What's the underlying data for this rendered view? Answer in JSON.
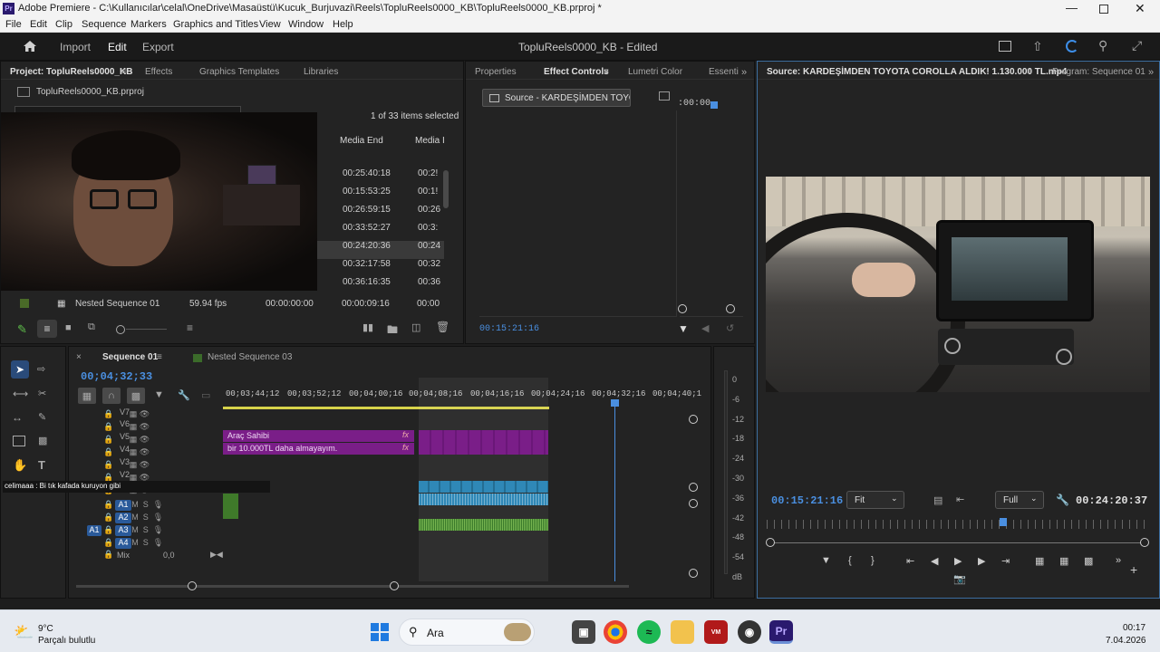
{
  "window": {
    "app_icon": "Pr",
    "title": "Adobe Premiere - C:\\Kullanıcılar\\celal\\OneDrive\\Masaüstü\\Kucuk_Burjuvazi\\Reels\\TopluReels0000_KB\\TopluReels0000_KB.prproj *"
  },
  "menu": [
    "File",
    "Edit",
    "Clip",
    "Sequence",
    "Markers",
    "Graphics and Titles",
    "View",
    "Window",
    "Help"
  ],
  "workspace": {
    "tabs": [
      "Import",
      "Edit",
      "Export"
    ],
    "active": "Edit",
    "project_title": "TopluReels0000_KB - Edited"
  },
  "project": {
    "tab": "Project: TopluReels0000_KB",
    "tabs": [
      "Effects",
      "Graphics Templates",
      "Libraries"
    ],
    "file": "TopluReels0000_KB.prproj",
    "selection": "1 of 33 items selected",
    "col_media_end": "Media End",
    "col_media_dur": "Media I",
    "rows": [
      {
        "end": "00:25:40:18",
        "dur": "00:2!"
      },
      {
        "end": "00:15:53:25",
        "dur": "00:1!"
      },
      {
        "end": "00:26:59:15",
        "dur": "00:26"
      },
      {
        "end": "00:33:52:27",
        "dur": "00:3:"
      },
      {
        "end": "00:24:20:36",
        "dur": "00:24"
      },
      {
        "end": "00:32:17:58",
        "dur": "00:32"
      },
      {
        "end": "00:36:16:35",
        "dur": "00:36"
      },
      {
        "end": "00:00:09:16",
        "dur": "00:00"
      }
    ],
    "nested_row": {
      "name": "Nested Sequence 01",
      "fps": "59.94 fps",
      "start": "00:00:00:00"
    }
  },
  "effects": {
    "tabs": [
      "Properties",
      "Effect Controls",
      "Lumetri Color",
      "Essenti"
    ],
    "source_label": "Source - KARDEŞİMDEN TOYO...",
    "mini_time": ":00:00",
    "time": "00:15:21:16"
  },
  "timeline": {
    "tabs": [
      "Sequence 01",
      "Nested Sequence 03"
    ],
    "timecode": "00;04;32;33",
    "ruler": [
      "00;03;44;12",
      "00;03;52;12",
      "00;04;00;16",
      "00;04;08;16",
      "00;04;16;16",
      "00;04;24;16",
      "00;04;32;16",
      "00;04;40;1"
    ],
    "video_tracks": [
      "V7",
      "V6",
      "V5",
      "V4",
      "V3",
      "V2",
      "V1"
    ],
    "audio_tracks": [
      "A1",
      "A2",
      "A3",
      "A4"
    ],
    "mix_label": "Mix",
    "mix_value": "0,0",
    "clips": [
      {
        "track": "V5",
        "text": "Araç Sahibi"
      },
      {
        "track": "V4",
        "text": "bir 10.000TL daha almayayım."
      }
    ],
    "fx": "fx",
    "caption_overlay": "celimaaa : Bi tık kafada kuruyon gibi"
  },
  "meter": {
    "scale": [
      "0",
      "-6",
      "-12",
      "-18",
      "-24",
      "-30",
      "-36",
      "-42",
      "-48",
      "-54",
      "dB"
    ]
  },
  "source": {
    "tab": "Source: KARDEŞİMDEN TOYOTA COROLLA ALDIK! 1.130.000 TL.mp4",
    "program_tab": "Program: Sequence 01",
    "time_in": "00:15:21:16",
    "fit": "Fit",
    "full": "Full",
    "duration": "00:24:20:37"
  },
  "taskbar": {
    "temp": "9°C",
    "weather": "Parçalı bulutlu",
    "search": "Ara",
    "clock": "00:17",
    "date": "7.04.2026"
  }
}
